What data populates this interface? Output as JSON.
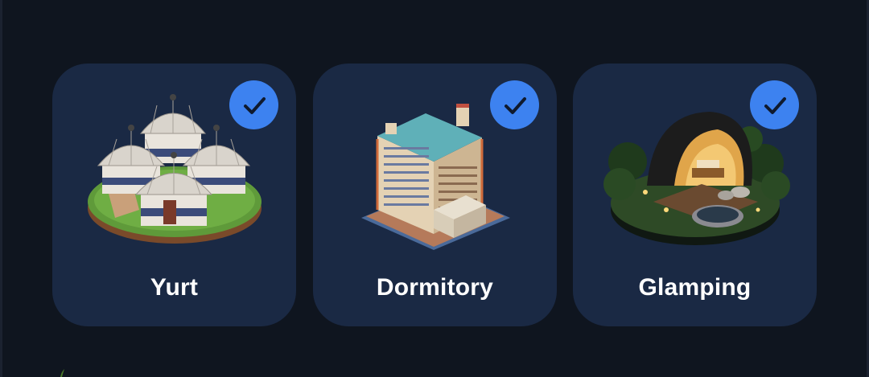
{
  "options": [
    {
      "label": "Yurt",
      "selected": true,
      "icon": "yurt-illustration"
    },
    {
      "label": "Dormitory",
      "selected": true,
      "icon": "dormitory-building-illustration"
    },
    {
      "label": "Glamping",
      "selected": true,
      "icon": "glamping-dome-illustration"
    }
  ],
  "colors": {
    "background": "#0f151f",
    "card": "#1a2944",
    "check_badge": "#3d82f0",
    "label_text": "#ffffff"
  }
}
